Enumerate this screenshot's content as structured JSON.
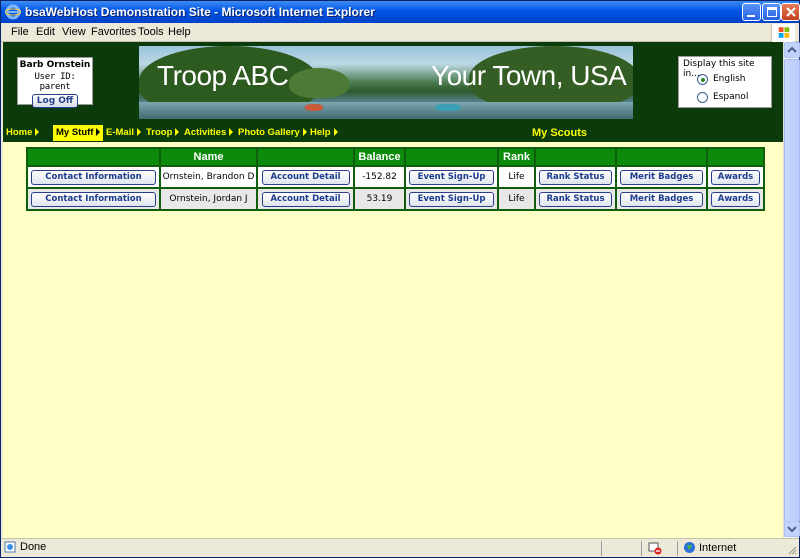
{
  "window": {
    "title": "bsaWebHost Demonstration Site - Microsoft Internet Explorer"
  },
  "menu": [
    "File",
    "Edit",
    "View",
    "Favorites",
    "Tools",
    "Help"
  ],
  "user": {
    "name": "Barb Ornstein",
    "id_label": "User ID:  parent",
    "logoff": "Log Off"
  },
  "banner": {
    "left_text": "Troop ABC",
    "right_text": "Your Town, USA"
  },
  "language": {
    "prompt": "Display this site in...",
    "options": [
      {
        "label": "English",
        "selected": true
      },
      {
        "label": "Espanol",
        "selected": false
      }
    ]
  },
  "nav": {
    "items": [
      "Home",
      "My Stuff",
      "E-Mail",
      "Troop",
      "Activities",
      "Photo Gallery",
      "Help"
    ],
    "active": "My Stuff",
    "page_title": "My Scouts"
  },
  "table": {
    "headers": [
      "",
      "Name",
      "",
      "Balance",
      "",
      "Rank",
      "",
      "",
      ""
    ],
    "rows": [
      {
        "contact": "Contact Information",
        "name": "Ornstein, Brandon D",
        "account": "Account Detail",
        "balance": "-152.82",
        "event": "Event Sign-Up",
        "rank": "Life",
        "rank_status": "Rank Status",
        "merit": "Merit Badges",
        "awards": "Awards"
      },
      {
        "contact": "Contact Information",
        "name": "Ornstein, Jordan J",
        "account": "Account Detail",
        "balance": "53.19",
        "event": "Event Sign-Up",
        "rank": "Life",
        "rank_status": "Rank Status",
        "merit": "Merit Badges",
        "awards": "Awards"
      }
    ]
  },
  "status": {
    "text": "Done",
    "zone": "Internet"
  },
  "colors": {
    "page_bg": "#ffffc6",
    "header_bg": "#0b3a0b",
    "nav_text": "#ffff00",
    "table_header": "#0b8a0b"
  }
}
